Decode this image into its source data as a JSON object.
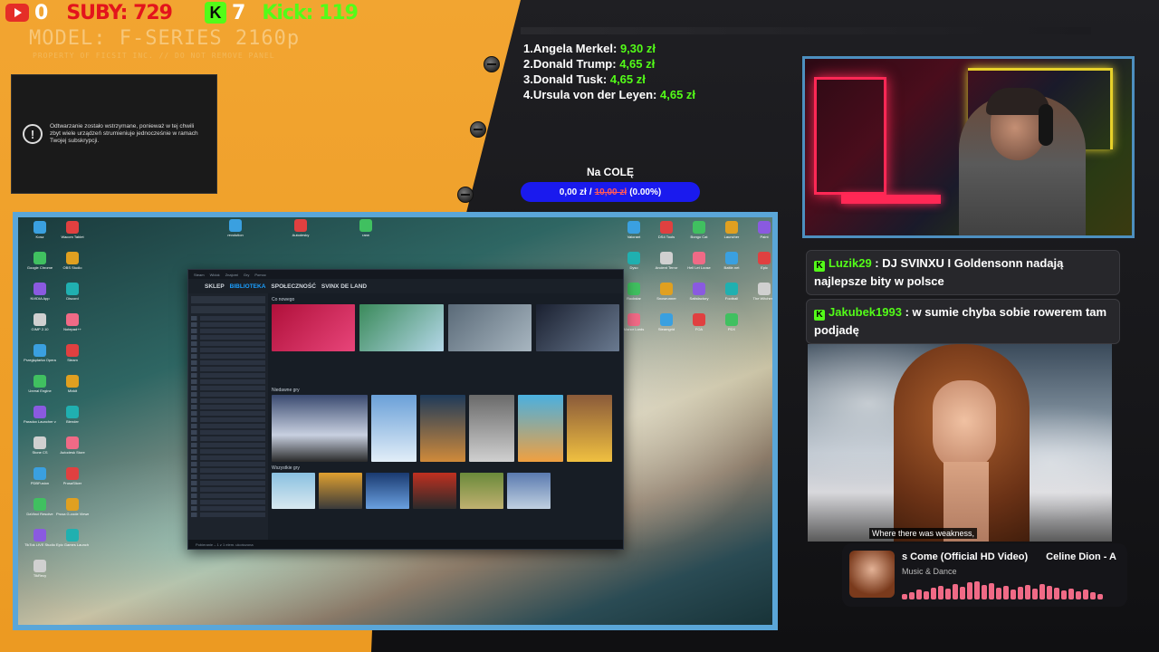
{
  "topbar": {
    "youtube_count": "0",
    "suby": "SUBY: 729",
    "kick_icon": "K",
    "kick_count": "7",
    "kick_label": "Kick: 119"
  },
  "panel": {
    "model": "MODEL: F-SERIES 2160p",
    "property": "PROPERTY OF FICSIT INC. // DO NOT REMOVE PANEL"
  },
  "notice": {
    "icon": "exclamation-icon",
    "text": "Odtwarzanie zostało wstrzymane, ponieważ w tej chwili zbyt wiele urządzeń strumieniuje jednocześnie w ramach Twojej subskrypcji."
  },
  "leaderboard": [
    {
      "rank": "1.",
      "name": "Angela Merkel:",
      "amount": "9,30 zł"
    },
    {
      "rank": "2.",
      "name": "Donald Trump:",
      "amount": "4,65 zł"
    },
    {
      "rank": "3.",
      "name": "Donald Tusk:",
      "amount": "4,65 zł"
    },
    {
      "rank": "4.",
      "name": "Ursula von der Leyen:",
      "amount": "4,65 zł"
    }
  ],
  "goal": {
    "title": "Na COLĘ",
    "current": "0,00 zł",
    "separator": "/",
    "target": "10,00 zł",
    "percent": "(0.00%)",
    "progress": 0
  },
  "chat": [
    {
      "platform": "K",
      "user": "Luzik29",
      "sep": " : ",
      "text": "DJ SVINXU I Goldensonn nadają najlepsze bity w polsce"
    },
    {
      "platform": "K",
      "user": "Jakubek1993",
      "sep": " : ",
      "text": "w sumie chyba sobie rowerem tam podjadę"
    }
  ],
  "video": {
    "subtitle": "Where there was weakness,"
  },
  "music": {
    "title": "s Come (Official HD Video)",
    "artist": "Celine Dion - A",
    "genre": "Music & Dance"
  },
  "steam": {
    "titlebar": [
      "Steam",
      "Widok",
      "Znajomi",
      "Gry",
      "Pomoc"
    ],
    "nav": [
      "SKLEP",
      "BIBLIOTEKA",
      "SPOŁECZNOŚĆ",
      "SVINX DE LAND"
    ],
    "section_new": "Co nowego",
    "section_recent": "Niedawne gry",
    "section_all": "Wszystkie gry",
    "status": "Pobieranie – 1 z 1 elem. ukończona"
  },
  "desktop_icons_left": [
    "Kosz",
    "Wacom Tablet",
    "Google Chrome",
    "OBS Studio",
    "NVIDIA App",
    "Discord",
    "GIMP 2.10",
    "Notepad++",
    "Przeglądarka Opera",
    "Steam",
    "Unreal Engine",
    "Mixkit",
    "Paradox Launcher v2",
    "Blender",
    "Stone CS",
    "Autodesk Store",
    "PDBFusion",
    "PrusaSlicer",
    "DaVinci Resolve",
    "Prusa G-code Viewer",
    "TikTok LIVE Studio",
    "Epic Games Launcher",
    "TikRecy"
  ],
  "desktop_icons_top": [
    "revolution",
    "Autodesky",
    "rarw"
  ],
  "desktop_icons_right": [
    "Valorant",
    "DS4 Tools",
    "Bongo Cat",
    "Launcher",
    "Paint",
    "Dyso",
    "Ancient Terror",
    "Hell Let Loose",
    "Battle.net",
    "Epic",
    "Rockstar",
    "Snowrunner",
    "Satisfactory",
    "Football",
    "The Witcher 3",
    "Manor Lords",
    "Steamgrid",
    "FOA",
    "PDX"
  ],
  "colors": {
    "orange_panel": "#ec9a22",
    "kick_green": "#53fc18",
    "suby_red": "#e3141c",
    "goal_blue": "#1a1aee",
    "screen_border": "#5aa6d8"
  }
}
